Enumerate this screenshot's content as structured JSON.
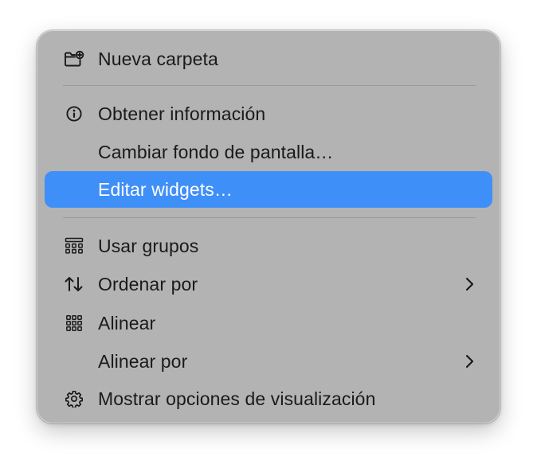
{
  "menu": {
    "items": [
      {
        "id": "nueva-carpeta",
        "label": "Nueva carpeta",
        "icon": "folder-plus-icon"
      },
      {
        "id": "obtener-informacion",
        "label": "Obtener información",
        "icon": "info-circle-icon"
      },
      {
        "id": "cambiar-fondo",
        "label": "Cambiar fondo de pantalla…"
      },
      {
        "id": "editar-widgets",
        "label": "Editar widgets…",
        "highlighted": true
      },
      {
        "id": "usar-grupos",
        "label": "Usar grupos",
        "icon": "groups-grid-icon"
      },
      {
        "id": "ordenar-por",
        "label": "Ordenar por",
        "icon": "sort-arrows-icon",
        "submenu": true
      },
      {
        "id": "alinear",
        "label": "Alinear",
        "icon": "grid-dots-icon"
      },
      {
        "id": "alinear-por",
        "label": "Alinear por",
        "submenu": true
      },
      {
        "id": "mostrar-opciones",
        "label": "Mostrar opciones de visualización",
        "icon": "gear-icon"
      }
    ]
  },
  "colors": {
    "menu_background": "#b3b3b3",
    "highlight": "#3f8ff8",
    "text": "#1a1a1a",
    "separator": "#9a9a9a"
  }
}
